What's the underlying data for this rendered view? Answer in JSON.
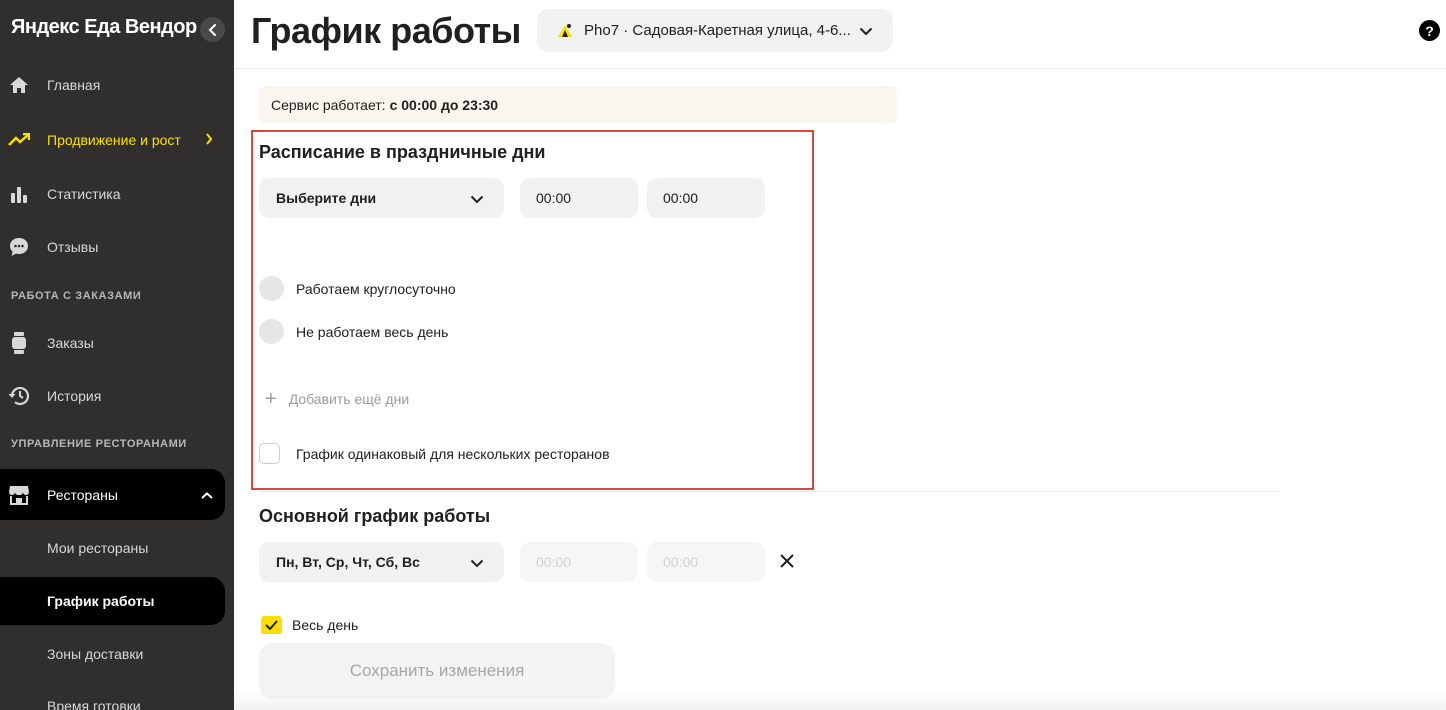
{
  "sidebar": {
    "brand": "Яндекс Еда Вендор",
    "nav": [
      {
        "label": "Главная",
        "icon": "home-icon"
      },
      {
        "label": "Продвижение и рост",
        "icon": "trending-up-icon"
      },
      {
        "label": "Статистика",
        "icon": "bar-chart-icon"
      },
      {
        "label": "Отзывы",
        "icon": "chat-icon"
      }
    ],
    "section_orders": "РАБОТА С ЗАКАЗАМИ",
    "orders_nav": [
      {
        "label": "Заказы",
        "icon": "watch-icon"
      },
      {
        "label": "История",
        "icon": "history-icon"
      }
    ],
    "section_restaurants": "УПРАВЛЕНИЕ РЕСТОРАНАМИ",
    "restaurants": {
      "label": "Рестораны",
      "icon": "store-icon"
    },
    "sub_items": [
      "Мои рестораны",
      "График работы",
      "Зоны доставки",
      "Время готовки"
    ]
  },
  "header": {
    "title": "График работы",
    "restaurant": "Pho7 · Садовая-Каретная улица, 4-6...",
    "help": "?"
  },
  "notice": {
    "prefix": "Сервис работает:",
    "hours": "с 00:00 до 23:30"
  },
  "holiday": {
    "title": "Расписание в праздничные дни",
    "days_placeholder": "Выберите дни",
    "time_from": "00:00",
    "time_to": "00:00",
    "around_the_clock": "Работаем круглосуточно",
    "closed_all_day": "Не работаем весь день",
    "add_more_days": "Добавить ещё дни",
    "same_schedule": "График одинаковый для нескольких ресторанов"
  },
  "main_schedule": {
    "title": "Основной график работы",
    "days": "Пн, Вт, Ср, Чт, Сб, Вс",
    "time_from": "00:00",
    "time_to": "00:00",
    "all_day": "Весь день"
  },
  "save_label": "Сохранить изменения",
  "colors": {
    "accent": "#fce000",
    "sidebar_bg": "#302f2d",
    "highlight": "#e0453a"
  }
}
